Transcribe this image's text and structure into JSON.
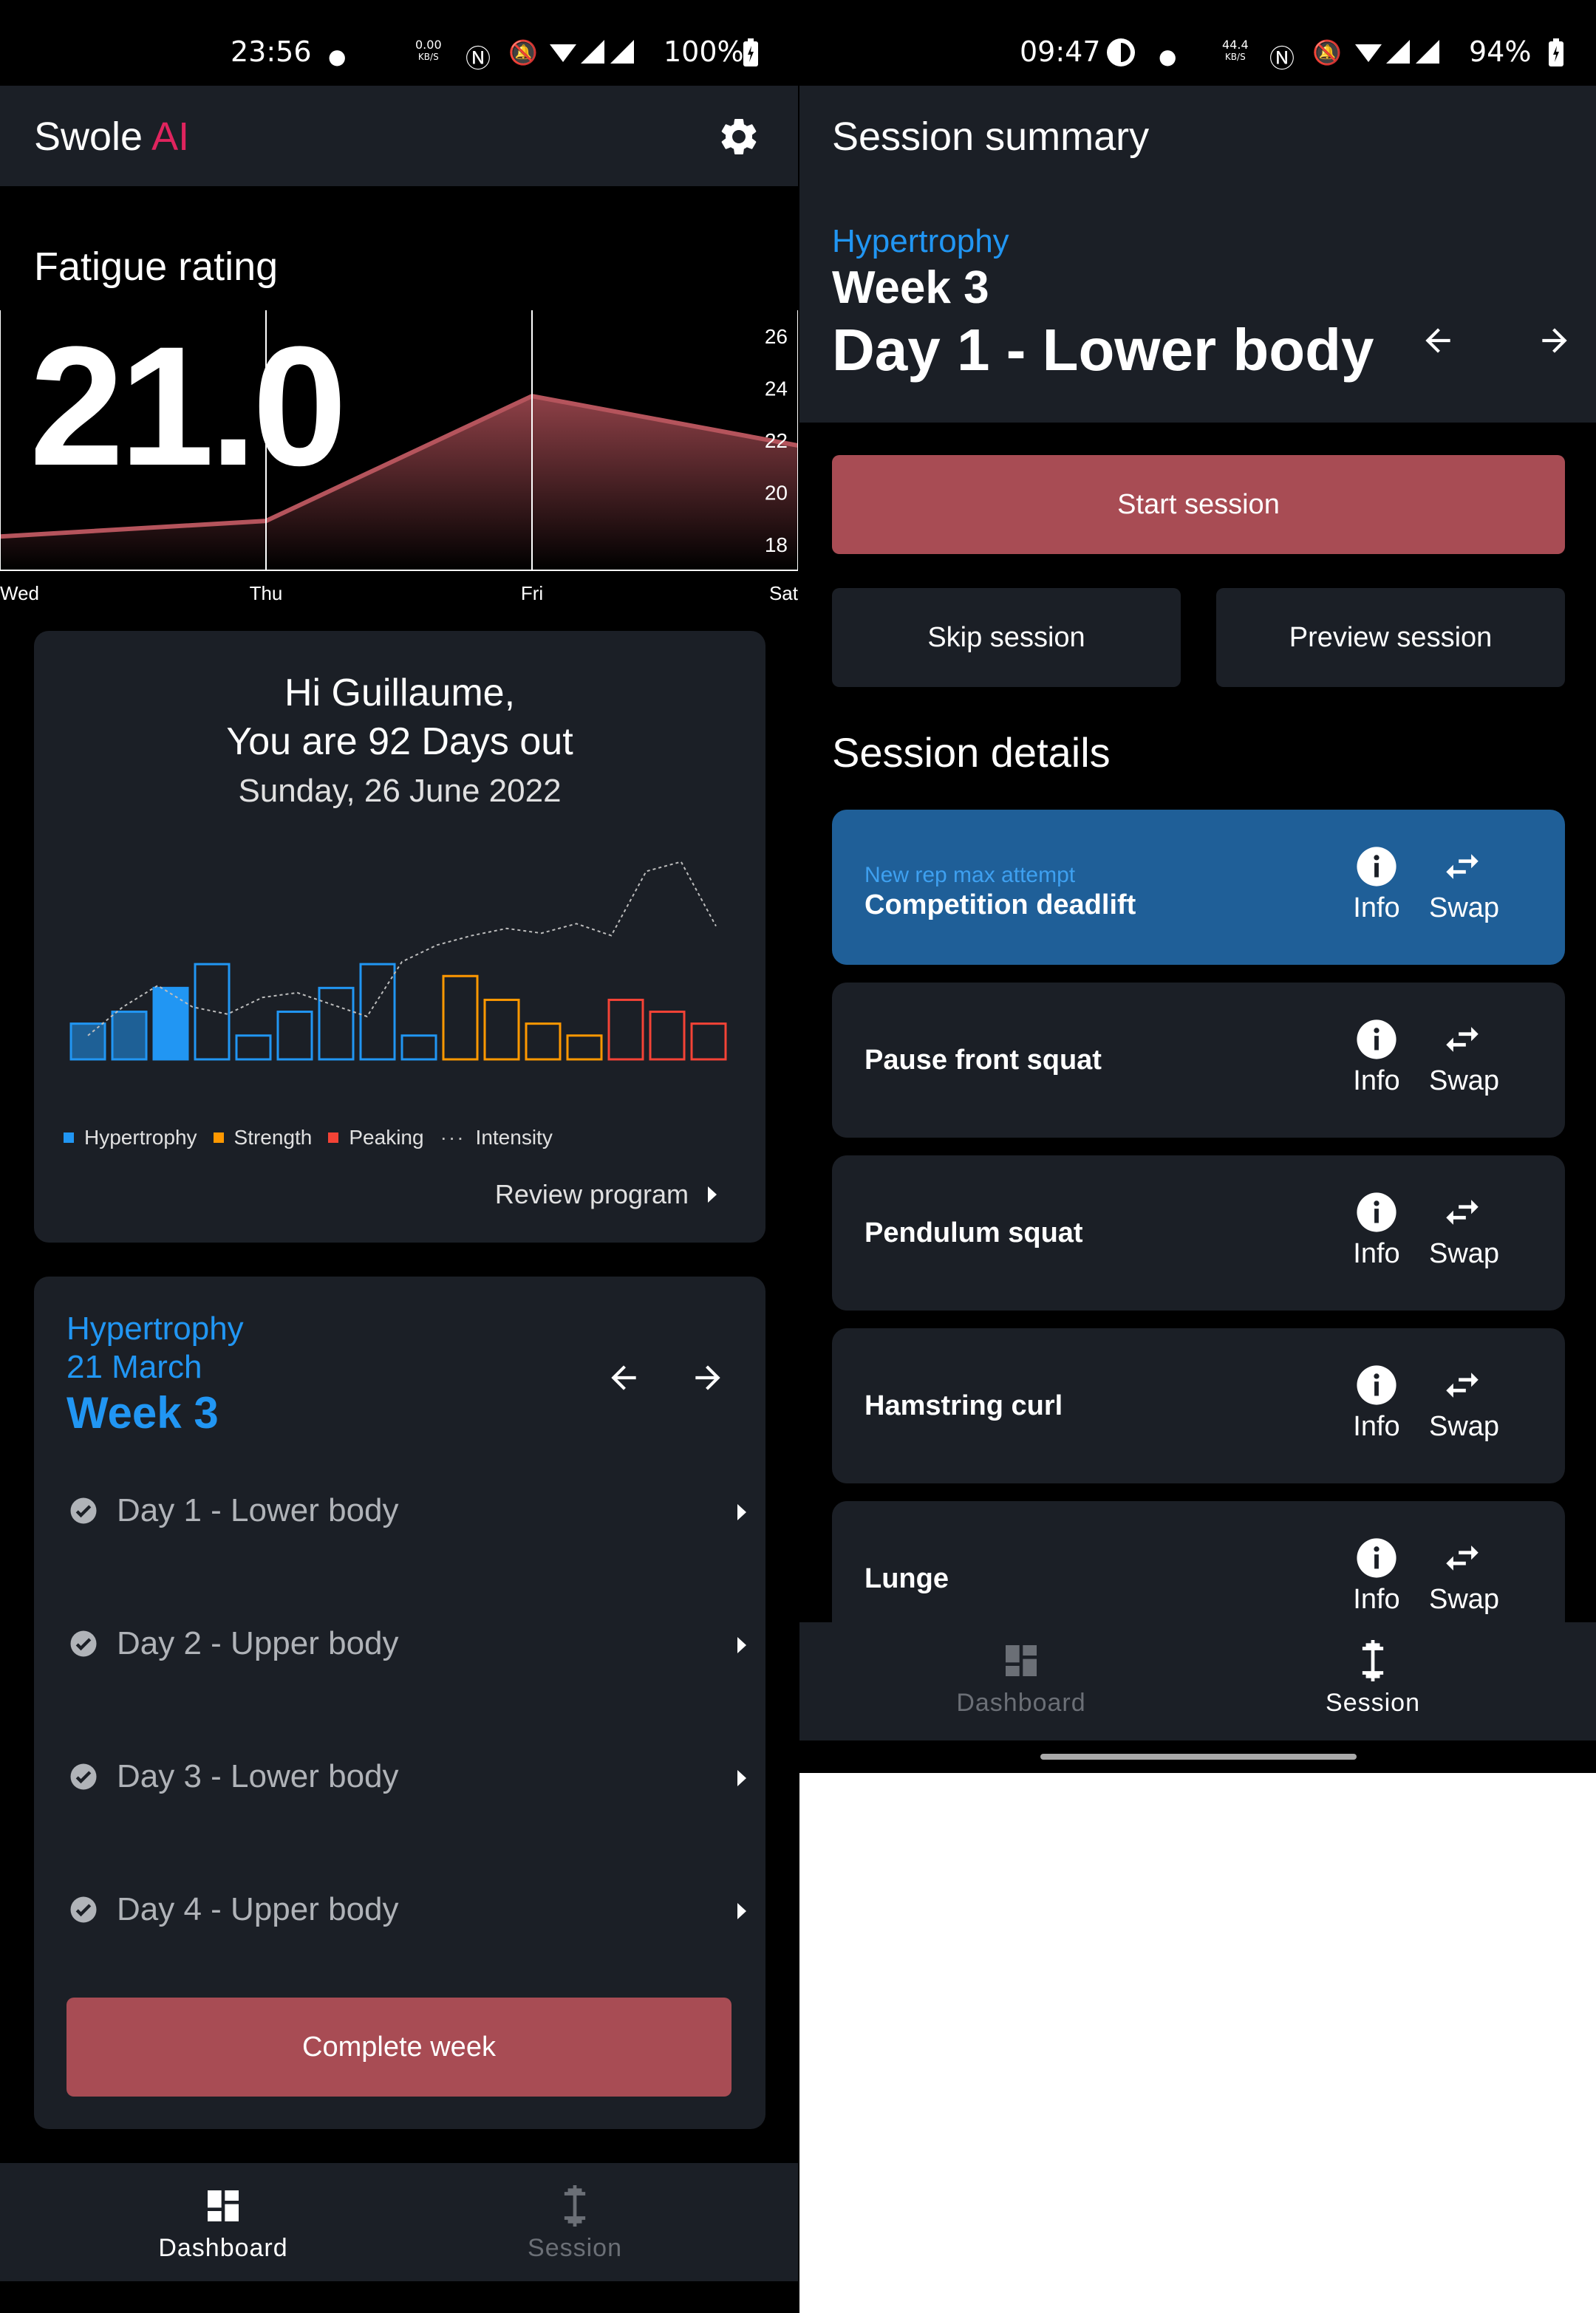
{
  "left": {
    "status": {
      "time": "23:56",
      "net_speed": "0.00",
      "net_unit": "KB/S",
      "battery": "100%"
    },
    "app_title": {
      "part1": "Swole ",
      "part2": "AI"
    },
    "fatigue": {
      "label": "Fatigue rating",
      "value": "21.0",
      "chart_data": {
        "type": "area",
        "categories": [
          "Wed",
          "Thu",
          "Fri",
          "Sat"
        ],
        "values": [
          18.3,
          18.9,
          23.7,
          21.8
        ],
        "yticks": [
          "26",
          "24",
          "22",
          "20",
          "18"
        ],
        "ylim": [
          17,
          27
        ]
      }
    },
    "greeting": {
      "line1": "Hi Guillaume,",
      "line2": "You are 92 Days out",
      "date": "Sunday, 26 June 2022",
      "review_label": "Review program"
    },
    "program_chart": {
      "chart_data": {
        "type": "bar",
        "series": [
          {
            "name": "Hypertrophy",
            "values": [
              1.5,
              2,
              3,
              4,
              1,
              2,
              3,
              4,
              1
            ]
          },
          {
            "name": "Strength",
            "values": [
              3.5,
              2.5,
              1.5,
              1
            ]
          },
          {
            "name": "Peaking",
            "values": [
              2.5,
              2,
              1.5
            ]
          },
          {
            "name": "Intensity",
            "values": [
              1,
              2.2,
              3.1,
              2.2,
              1.9,
              2.6,
              2.8,
              2.3,
              1.8,
              4.1,
              4.8,
              5.2,
              5.5,
              5.3,
              5.7,
              5.2,
              7.9,
              8.3,
              5.6
            ]
          }
        ],
        "legend": [
          "Hypertrophy",
          "Strength",
          "Peaking",
          "Intensity"
        ],
        "colors": {
          "Hypertrophy": "#2196f3",
          "Strength": "#ff9800",
          "Peaking": "#f44336",
          "Intensity": "#bdbdbd"
        }
      }
    },
    "week_card": {
      "program": "Hypertrophy",
      "date": "21 March",
      "week": "Week 3",
      "days": [
        "Day 1 - Lower body",
        "Day 2 - Upper body",
        "Day 3 - Lower body",
        "Day 4 - Upper body"
      ],
      "complete_label": "Complete week"
    },
    "nav": {
      "dashboard": "Dashboard",
      "session": "Session"
    }
  },
  "right": {
    "status": {
      "time": "09:47",
      "net_speed": "44.4",
      "net_unit": "KB/S",
      "battery": "94%"
    },
    "title": "Session summary",
    "program": "Hypertrophy",
    "week": "Week 3",
    "day": "Day 1 - Lower body",
    "start_label": "Start session",
    "skip_label": "Skip session",
    "preview_label": "Preview session",
    "details_title": "Session details",
    "exercises": [
      {
        "tag": "New rep max attempt",
        "name": "Competition deadlift"
      },
      {
        "tag": "",
        "name": "Pause front squat"
      },
      {
        "tag": "",
        "name": "Pendulum squat"
      },
      {
        "tag": "",
        "name": "Hamstring curl"
      },
      {
        "tag": "",
        "name": "Lunge"
      }
    ],
    "info_label": "Info",
    "swap_label": "Swap",
    "nav": {
      "dashboard": "Dashboard",
      "session": "Session"
    }
  }
}
